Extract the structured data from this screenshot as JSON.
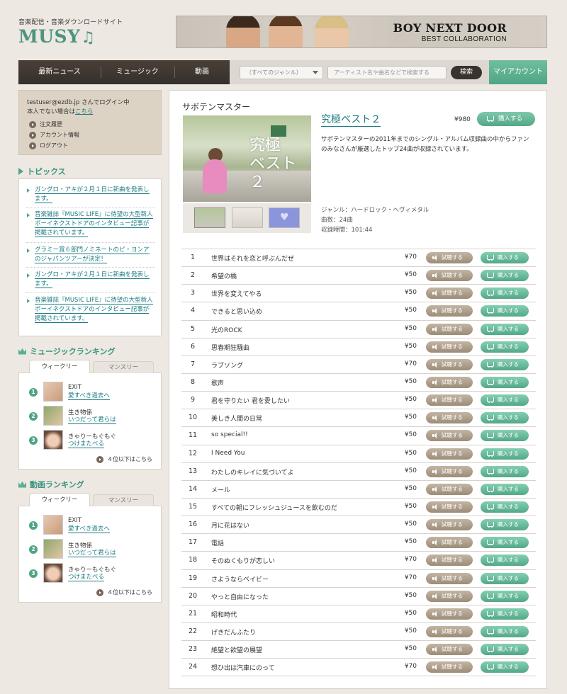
{
  "header": {
    "tagline": "音楽配信・音楽ダウンロードサイト",
    "logo_text": "MUSY",
    "logo_mark": "♫",
    "banner_title": "BOY NEXT DOOR",
    "banner_subtitle": "BEST COLLABORATION"
  },
  "nav": {
    "items": [
      "最新ニュース",
      "ミュージック",
      "動画"
    ],
    "genre_select": "（すべてのジャンル）",
    "search_placeholder": "アーティスト名や曲名などで検索する",
    "search_button": "検索",
    "account_button": "マイアカウント"
  },
  "login": {
    "line1_email": "testuser@ezdb.jp",
    "line1_suffix": " さんでログイン中",
    "line2_prefix": "本人でない場合は",
    "line2_link": "こちら",
    "menu": [
      "注文履歴",
      "アカウント情報",
      "ログアウト"
    ]
  },
  "topics": {
    "title": "トピックス",
    "items": [
      "ガングロ・アキが２月１日に新曲を発表します。",
      "音楽雑誌『MUSIC LIFE』に待望の大型新人ボーイネクストドアのインタビュー記事が掲載されています。",
      "グラミー賞６部門ノミネートのピ・ヨンアのジャパンツアーが決定！",
      "ガングロ・アキが２月１日に新曲を発表します。",
      "音楽雑誌『MUSIC LIFE』に待望の大型新人ボーイネクストドアのインタビュー記事が掲載されています。"
    ]
  },
  "music_ranking": {
    "title": "ミュージックランキング",
    "tabs": [
      "ウィークリー",
      "マンスリー"
    ],
    "items": [
      {
        "rank": "1",
        "artist": "EXIT",
        "title": "愛すべき過去へ"
      },
      {
        "rank": "2",
        "artist": "生き物係",
        "title": "いつだって君らは"
      },
      {
        "rank": "3",
        "artist": "きゃりーもぐもぐ",
        "title": "つけまたべる"
      }
    ],
    "more": "４位以下はこちら"
  },
  "video_ranking": {
    "title": "動画ランキング",
    "tabs": [
      "ウィークリー",
      "マンスリー"
    ],
    "items": [
      {
        "rank": "1",
        "artist": "EXIT",
        "title": "愛すべき過去へ"
      },
      {
        "rank": "2",
        "artist": "生き物係",
        "title": "いつだって君らは"
      },
      {
        "rank": "3",
        "artist": "きゃりーもぐもぐ",
        "title": "つけまたべる"
      }
    ],
    "more": "４位以下はこちら"
  },
  "album": {
    "artist": "サボテンマスター",
    "title": "究極ベスト２",
    "price": "¥980",
    "buy_label": "購入する",
    "cover_text": "究極\nベスト２",
    "description": "サボテンマスターの2011年までのシングル・アルバム収録曲の中からファンのみなさんが厳選したトップ24曲が収録されています。",
    "genre": "ジャンル：ハードロック・ヘヴィメタル",
    "count": "曲数：24曲",
    "duration": "収録時間：101:44"
  },
  "track_buttons": {
    "listen": "試聴する",
    "buy": "購入する"
  },
  "tracks": [
    {
      "no": "1",
      "title": "世界はそれを恋と呼ぶんだぜ",
      "price": "¥70"
    },
    {
      "no": "2",
      "title": "希望の橋",
      "price": "¥50"
    },
    {
      "no": "3",
      "title": "世界を変えてやる",
      "price": "¥50"
    },
    {
      "no": "4",
      "title": "できると思い込め",
      "price": "¥50"
    },
    {
      "no": "5",
      "title": "光のROCK",
      "price": "¥50"
    },
    {
      "no": "6",
      "title": "思春期狂騒曲",
      "price": "¥50"
    },
    {
      "no": "7",
      "title": "ラブソング",
      "price": "¥70"
    },
    {
      "no": "8",
      "title": "歌声",
      "price": "¥50"
    },
    {
      "no": "9",
      "title": "君を守りたい 君を愛したい",
      "price": "¥50"
    },
    {
      "no": "10",
      "title": "美しき人間の日常",
      "price": "¥50"
    },
    {
      "no": "11",
      "title": "so special!!",
      "price": "¥50"
    },
    {
      "no": "12",
      "title": "I Need You",
      "price": "¥50"
    },
    {
      "no": "13",
      "title": "わたしのキレイに気づいてよ",
      "price": "¥50"
    },
    {
      "no": "14",
      "title": "メール",
      "price": "¥50"
    },
    {
      "no": "15",
      "title": "すべての朝にフレッシュジュースを飲むのだ",
      "price": "¥50"
    },
    {
      "no": "16",
      "title": "月に花はない",
      "price": "¥50"
    },
    {
      "no": "17",
      "title": "電話",
      "price": "¥50"
    },
    {
      "no": "18",
      "title": "そのぬくもりが恋しい",
      "price": "¥70"
    },
    {
      "no": "19",
      "title": "さようならベイビー",
      "price": "¥70"
    },
    {
      "no": "20",
      "title": "やっと自由になった",
      "price": "¥50"
    },
    {
      "no": "21",
      "title": "昭和時代",
      "price": "¥50"
    },
    {
      "no": "22",
      "title": "げきだんふたり",
      "price": "¥50"
    },
    {
      "no": "23",
      "title": "絶望と欲望の展望",
      "price": "¥50"
    },
    {
      "no": "24",
      "title": "想ひ出は汽車にのって",
      "price": "¥70"
    }
  ]
}
